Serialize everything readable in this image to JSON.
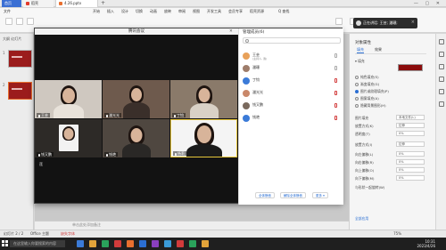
{
  "titlebar": {
    "home_tab": "首页",
    "wps_tab": "稻壳",
    "file_tab": "4.26.pptx",
    "plus": "+",
    "window_controls": "— ▢ ✕"
  },
  "menu": [
    "文件",
    "开始",
    "插入",
    "设计",
    "切换",
    "动画",
    "放映",
    "审阅",
    "视图",
    "开发工具",
    "会员专享",
    "稻壳资源"
  ],
  "menu_search": "Q 查找",
  "left_panel": {
    "tabs": "大纲  幻灯片",
    "slide_numbers": [
      "1",
      "2"
    ]
  },
  "notes_placeholder": "单击此处添加备注",
  "meeting": {
    "title": "腾讯会议",
    "close": "✕",
    "participants": [
      {
        "name": "王芸"
      },
      {
        "name": "潘光光"
      },
      {
        "name": "丁钧"
      },
      {
        "name": "钱又鹏"
      },
      {
        "name": "钱艳"
      },
      {
        "name": "杨莉"
      }
    ],
    "bottom_tag": "莲"
  },
  "members_panel": {
    "title": "管理成员(6)",
    "members": [
      {
        "name": "王芸",
        "role": "(主持人, 我)"
      },
      {
        "name": "潘珊",
        "role": ""
      },
      {
        "name": "丁钧",
        "role": ""
      },
      {
        "name": "潘光光",
        "role": ""
      },
      {
        "name": "钱又鹏",
        "role": ""
      },
      {
        "name": "钱艳",
        "role": ""
      }
    ],
    "buttons": [
      "全体静音",
      "解除全体静音",
      "更多 ▾"
    ]
  },
  "toast": {
    "text": "正在讲话: 王芸; 潘珊;"
  },
  "right_panel": {
    "title": "对象属性",
    "tabs": [
      "填充",
      "效果"
    ],
    "fill_label": "▾ 填充",
    "options": [
      {
        "label": "纯色填充(S)",
        "selected": false
      },
      {
        "label": "渐变填充(G)",
        "selected": false
      },
      {
        "label": "图片或纹理填充(P)",
        "selected": true
      },
      {
        "label": "图案填充(A)",
        "selected": false
      },
      {
        "label": "隐藏背景图形(H)",
        "selected": false
      }
    ],
    "fields": [
      {
        "label": "图片填充",
        "value": "本地文件(L)"
      },
      {
        "label": "放置方式(K)",
        "value": "拉伸"
      },
      {
        "label": "透明度(T)",
        "value": "0%"
      },
      {
        "label": "放置方式(I)",
        "value": "拉伸"
      },
      {
        "label": "向左偏移(L)",
        "value": "0%"
      },
      {
        "label": "向右偏移(R)",
        "value": "0%"
      },
      {
        "label": "向上偏移(O)",
        "value": "0%"
      },
      {
        "label": "向下偏移(M)",
        "value": "0%"
      }
    ],
    "checkbox": "与形状一起旋转(W)",
    "apply_all": "全部应用"
  },
  "statusbar": {
    "left": "幻灯片 2 / 2",
    "theme": "Office 主题",
    "missing_font": "缺失字体",
    "zoom": "75%"
  },
  "taskbar": {
    "search_placeholder": "在这里输入你要搜索的内容",
    "time": "10:31",
    "date": "2023/4/26",
    "apps": [
      "#3b7bd8",
      "#e2a43a",
      "#2aa35b",
      "#d23b3b",
      "#e86f2f",
      "#2b6fd3",
      "#8a3fbf",
      "#3b9bd8",
      "#d23b3b",
      "#2aa35b",
      "#e2a43a"
    ]
  }
}
